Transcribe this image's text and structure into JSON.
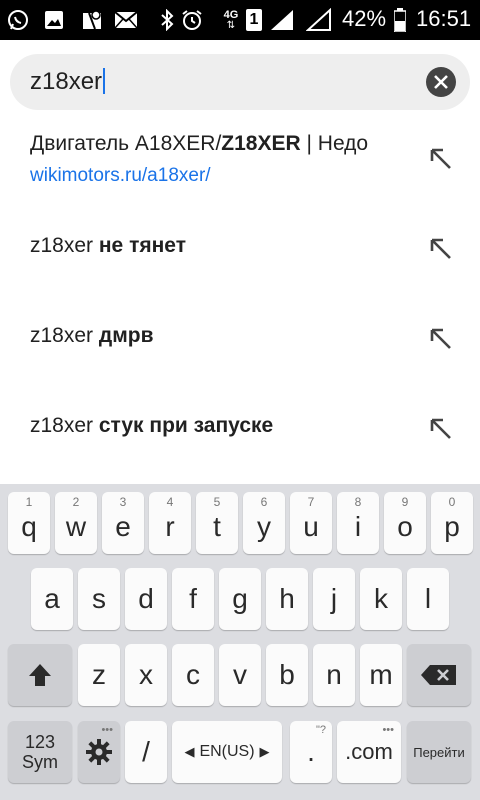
{
  "status_bar": {
    "battery_percent": "42%",
    "time": "16:51",
    "network": "4G",
    "sim": "1"
  },
  "search": {
    "query": "z18xer"
  },
  "suggestions": [
    {
      "prefix": "Двигатель A18XER/",
      "bold": "Z18XER",
      "suffix": " | Недо",
      "url": "wikimotors.ru/a18xer/"
    },
    {
      "prefix": "z18xer ",
      "bold": "не тянет",
      "suffix": ""
    },
    {
      "prefix": "z18xer ",
      "bold": "дмрв",
      "suffix": ""
    },
    {
      "prefix": "z18xer ",
      "bold": "стук при запуске",
      "suffix": ""
    }
  ],
  "keyboard": {
    "row1": [
      {
        "k": "q",
        "h": "1"
      },
      {
        "k": "w",
        "h": "2"
      },
      {
        "k": "e",
        "h": "3"
      },
      {
        "k": "r",
        "h": "4"
      },
      {
        "k": "t",
        "h": "5"
      },
      {
        "k": "y",
        "h": "6"
      },
      {
        "k": "u",
        "h": "7"
      },
      {
        "k": "i",
        "h": "8"
      },
      {
        "k": "o",
        "h": "9"
      },
      {
        "k": "p",
        "h": "0"
      }
    ],
    "row2": [
      "a",
      "s",
      "d",
      "f",
      "g",
      "h",
      "j",
      "k",
      "l"
    ],
    "row3": [
      "z",
      "x",
      "c",
      "v",
      "b",
      "n",
      "m"
    ],
    "sym_line1": "123",
    "sym_line2": "Sym",
    "slash": "/",
    "lang": "EN(US)",
    "period": ".",
    "period_hint": "\"?",
    "com": ".com",
    "go": "Перейти",
    "more_dots": "•••"
  }
}
